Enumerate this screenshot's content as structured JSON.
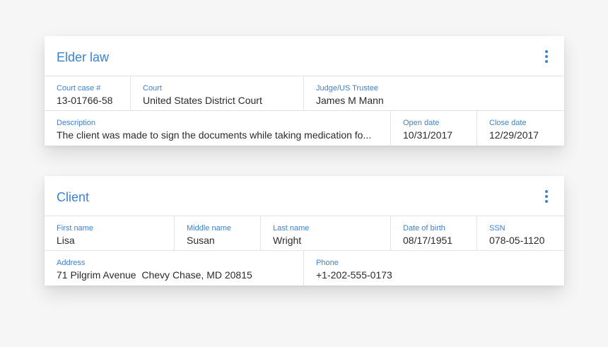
{
  "elder_law": {
    "title": "Elder law",
    "menu_icon": "more-vertical-icon",
    "row1": [
      {
        "label": "Court case #",
        "value": "13-01766-58"
      },
      {
        "label": "Court",
        "value": "United States District Court"
      },
      {
        "label": "Judge/US Trustee",
        "value": "James M Mann"
      }
    ],
    "row2": [
      {
        "label": "Description",
        "value": "The client was made to sign the documents while taking medication fo..."
      },
      {
        "label": "Open date",
        "value": "10/31/2017"
      },
      {
        "label": "Close date",
        "value": "12/29/2017"
      }
    ]
  },
  "client": {
    "title": "Client",
    "menu_icon": "more-vertical-icon",
    "row1": [
      {
        "label": "First name",
        "value": "Lisa"
      },
      {
        "label": "Middle name",
        "value": "Susan"
      },
      {
        "label": "Last name",
        "value": "Wright"
      },
      {
        "label": "Date of birth",
        "value": "08/17/1951"
      },
      {
        "label": "SSN",
        "value": "078-05-1120"
      }
    ],
    "row2": [
      {
        "label": "Address",
        "value": "71 Pilgrim Avenue  Chevy Chase, MD 20815"
      },
      {
        "label": "Phone",
        "value": "+1-202-555-0173"
      }
    ]
  },
  "colors": {
    "accent": "#3b82d6",
    "text": "#2b2b2b",
    "divider": "#e3e3e3",
    "background": "#f6f6f6"
  }
}
